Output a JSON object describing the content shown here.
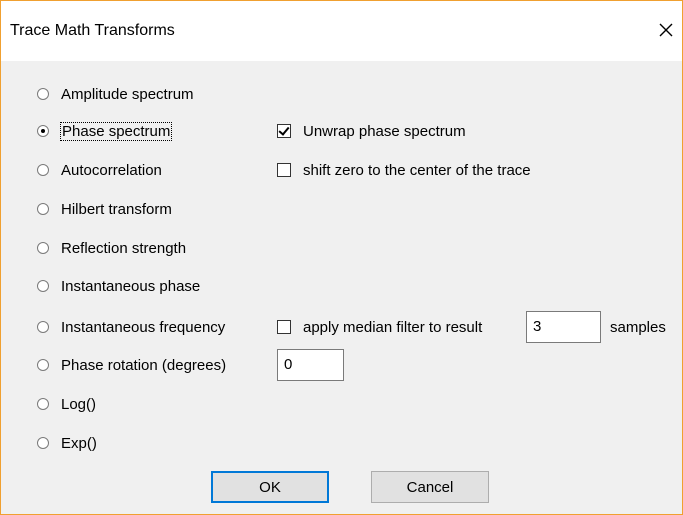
{
  "dialog": {
    "title": "Trace Math Transforms",
    "close_icon": "close-icon"
  },
  "options": [
    {
      "label": "Amplitude spectrum",
      "selected": false
    },
    {
      "label": "Phase spectrum",
      "selected": true
    },
    {
      "label": "Autocorrelation",
      "selected": false
    },
    {
      "label": "Hilbert transform",
      "selected": false
    },
    {
      "label": "Reflection strength",
      "selected": false
    },
    {
      "label": "Instantaneous phase",
      "selected": false
    },
    {
      "label": "Instantaneous frequency",
      "selected": false
    },
    {
      "label": "Phase rotation (degrees)",
      "selected": false
    },
    {
      "label": "Log()",
      "selected": false
    },
    {
      "label": "Exp()",
      "selected": false
    }
  ],
  "checkboxes": {
    "unwrap": {
      "label": "Unwrap phase spectrum",
      "checked": true
    },
    "shift_zero": {
      "label": "shift zero to the center of the trace",
      "checked": false
    },
    "median": {
      "label": "apply median filter to result",
      "checked": false
    }
  },
  "inputs": {
    "median_samples": "3",
    "samples_label": "samples",
    "phase_rotation": "0"
  },
  "buttons": {
    "ok": "OK",
    "cancel": "Cancel"
  },
  "colors": {
    "focus_border": "#0078d7",
    "window_border": "#f0a030"
  }
}
